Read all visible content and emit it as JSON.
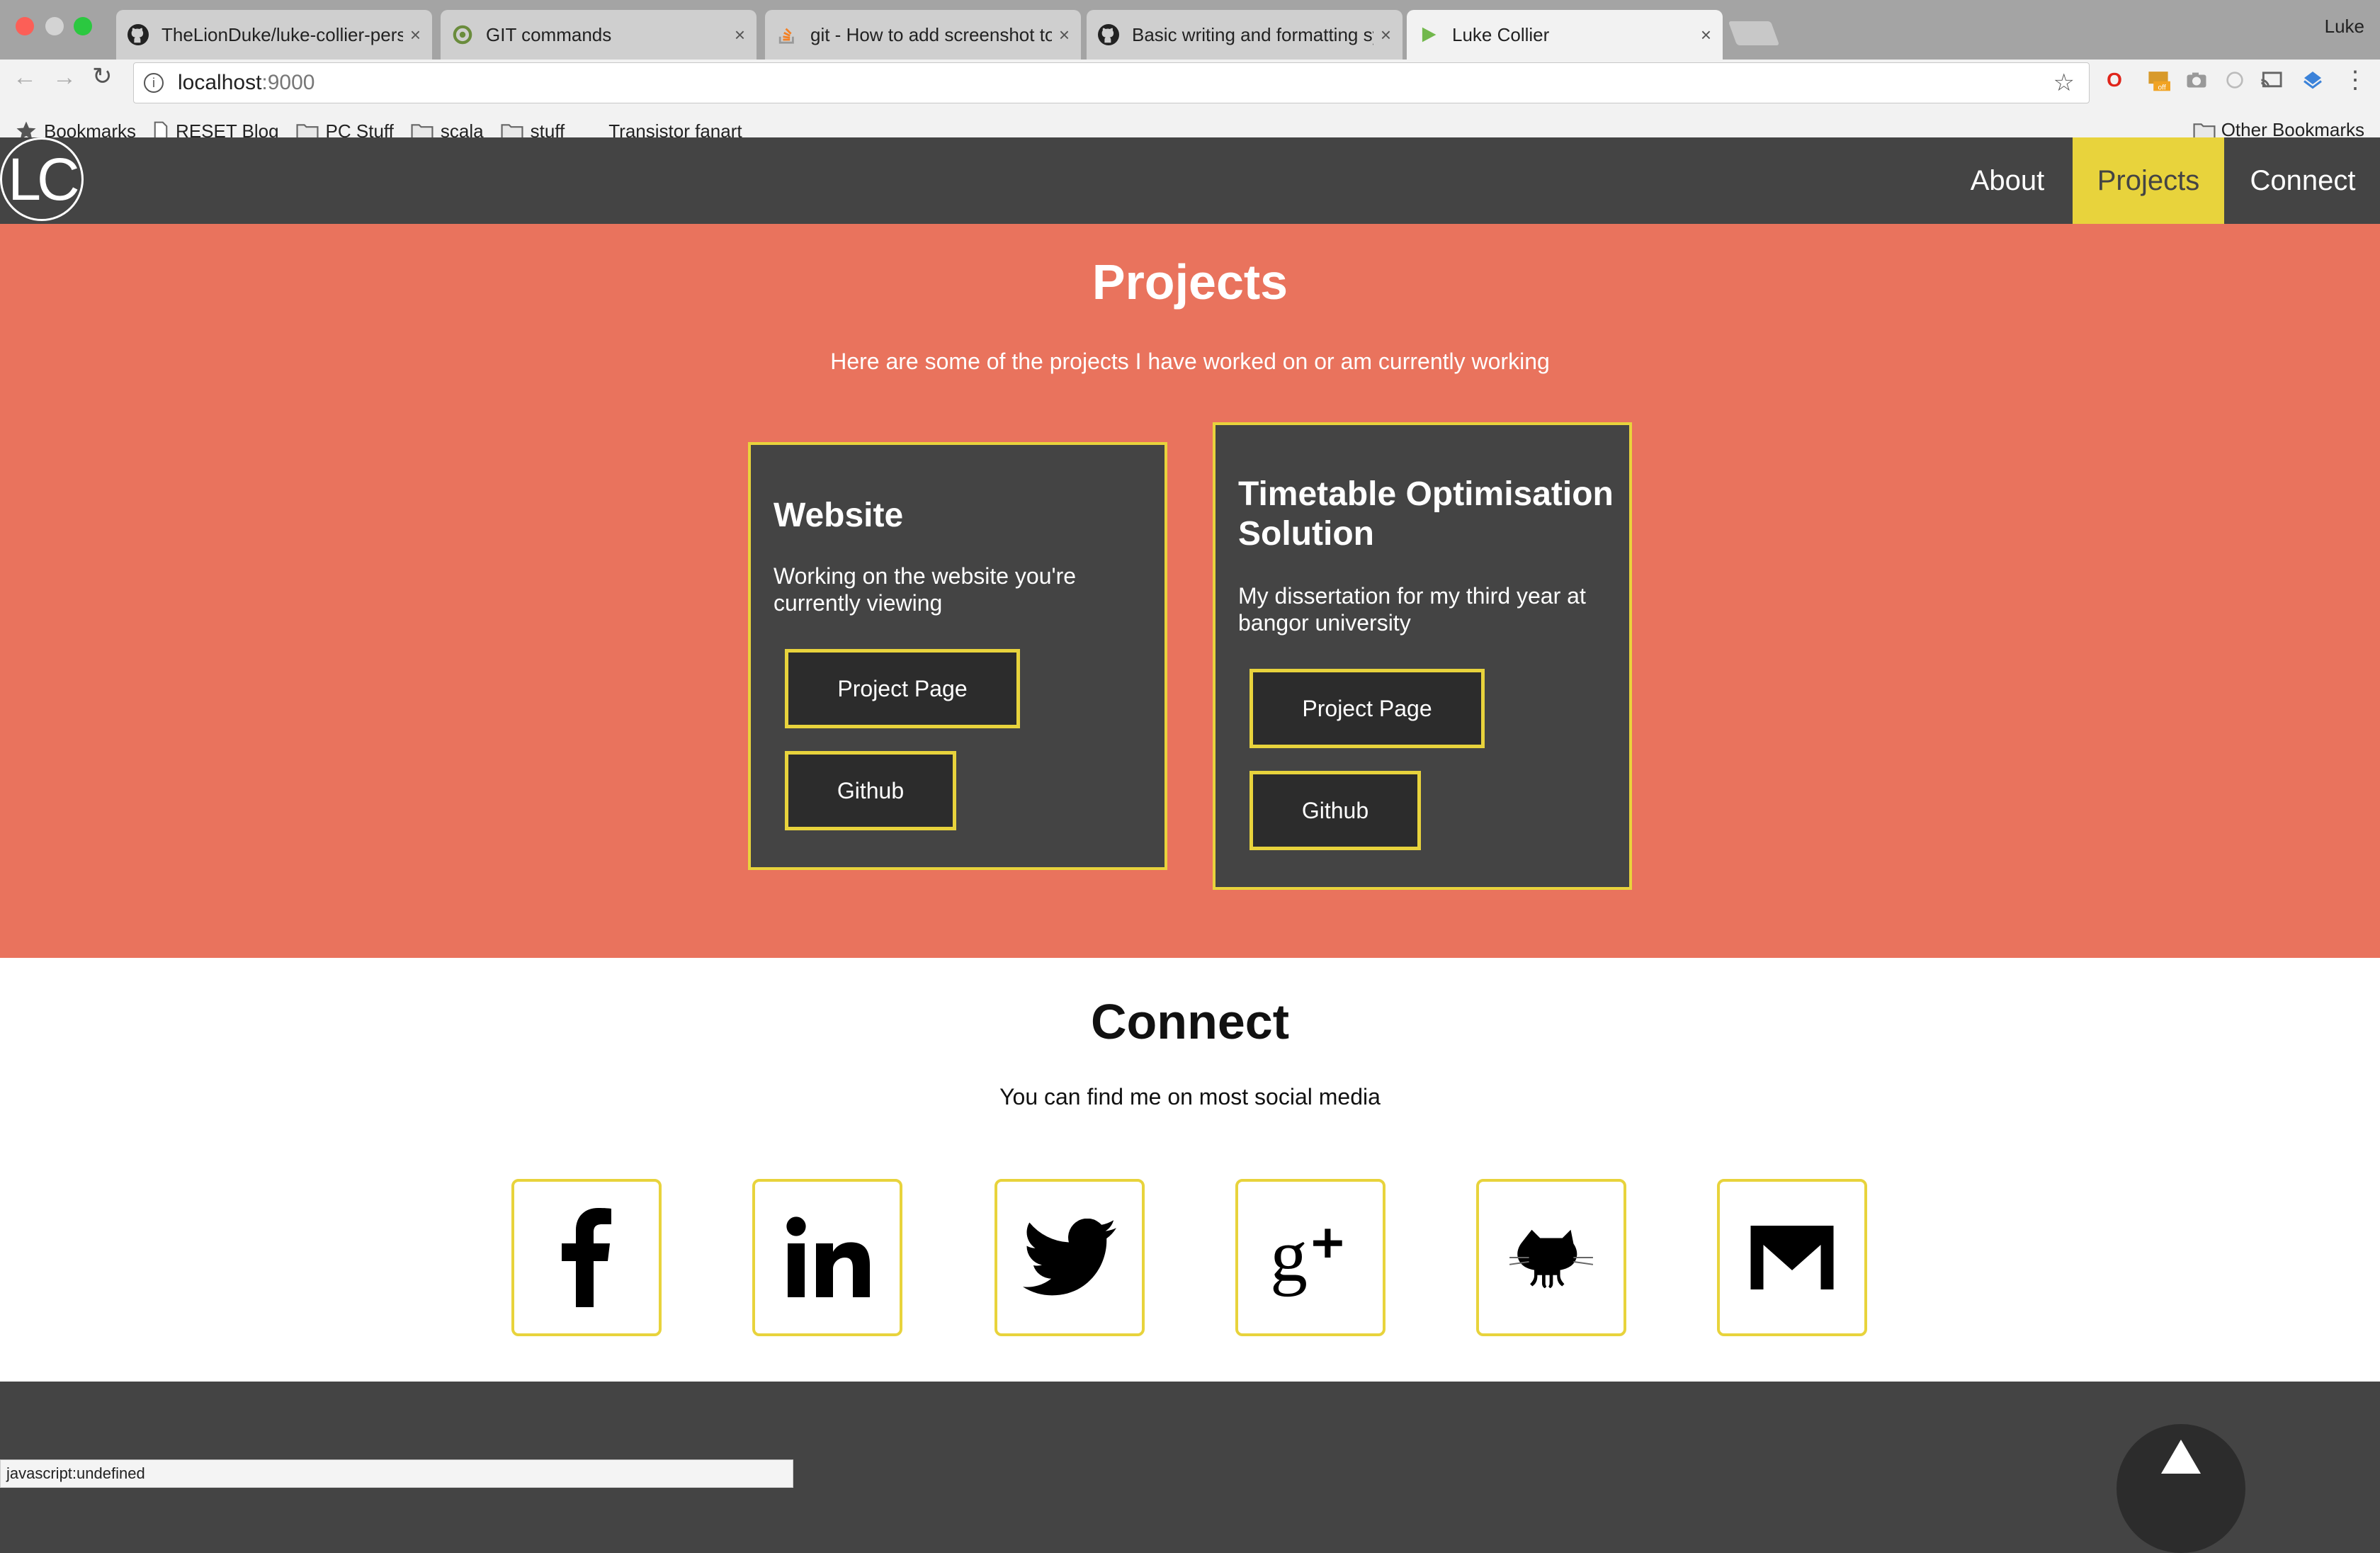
{
  "browser": {
    "tabs": [
      {
        "label": "TheLionDuke/luke-collier-pers",
        "icon": "github-icon"
      },
      {
        "label": "GIT commands",
        "icon": "site-icon"
      },
      {
        "label": "git - How to add screenshot to",
        "icon": "stackoverflow-icon"
      },
      {
        "label": "Basic writing and formatting sy",
        "icon": "github-icon"
      },
      {
        "label": "Luke Collier",
        "icon": "play-icon",
        "active": true
      }
    ],
    "profile": "Luke",
    "address": {
      "host": "localhost",
      "port": ":9000"
    },
    "bookmarks": [
      {
        "label": "Bookmarks",
        "icon": "star-icon"
      },
      {
        "label": "RESET Blog",
        "icon": "page-icon"
      },
      {
        "label": "PC Stuff",
        "icon": "folder-icon"
      },
      {
        "label": "scala",
        "icon": "folder-icon"
      },
      {
        "label": "stuff",
        "icon": "folder-icon"
      },
      {
        "label": "Transistor fanart",
        "icon": "none"
      }
    ],
    "other_bookmarks": "Other Bookmarks",
    "status_text": "javascript:undefined"
  },
  "site": {
    "logo": "LC",
    "nav": [
      {
        "label": "About"
      },
      {
        "label": "Projects",
        "active": true
      },
      {
        "label": "Connect"
      }
    ],
    "projects": {
      "title": "Projects",
      "subtitle": "Here are some of the projects I have worked on or am currently working",
      "cards": [
        {
          "title": "Website",
          "description": "Working on the website you're currently viewing",
          "buttons": [
            "Project Page",
            "Github"
          ]
        },
        {
          "title": "Timetable Optimisation Solution",
          "description": "My dissertation for my third year at bangor university",
          "buttons": [
            "Project Page",
            "Github"
          ]
        }
      ]
    },
    "connect": {
      "title": "Connect",
      "subtitle": "You can find me on most social media",
      "links": [
        "facebook-icon",
        "linkedin-icon",
        "twitter-icon",
        "google-plus-icon",
        "github-icon",
        "gmail-icon"
      ]
    }
  },
  "colors": {
    "accent": "#e8d33c",
    "projects_bg": "#e9735d",
    "dark": "#444444"
  }
}
